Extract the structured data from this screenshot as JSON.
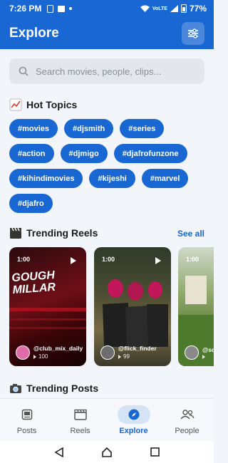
{
  "status_bar": {
    "time": "7:26 PM",
    "battery": "77%",
    "signal_label": "VoLTE"
  },
  "header": {
    "title": "Explore"
  },
  "search": {
    "placeholder": "Search movies, people, clips..."
  },
  "hot_topics": {
    "title": "Hot Topics",
    "chips": [
      [
        "#movies",
        "#djsmith",
        "#series"
      ],
      [
        "#action",
        "#djmigo",
        "#djafrofunzone"
      ],
      [
        "#kihindimovies",
        "#kijeshi",
        "#marvel"
      ],
      [
        "#djafro"
      ]
    ]
  },
  "trending_reels": {
    "title": "Trending Reels",
    "see_all": "See all",
    "items": [
      {
        "duration": "1:00",
        "user": "@club_mix_daily",
        "views": "100"
      },
      {
        "duration": "1:00",
        "user": "@flick_finder",
        "views": "99"
      },
      {
        "duration": "1:00",
        "user": "@scr",
        "views": ""
      }
    ],
    "reel1_overlay": [
      "GOUGH",
      "MILLAR"
    ]
  },
  "trending_posts": {
    "title": "Trending Posts"
  },
  "bottom_nav": {
    "items": [
      {
        "label": "Posts",
        "active": false
      },
      {
        "label": "Reels",
        "active": false
      },
      {
        "label": "Explore",
        "active": true
      },
      {
        "label": "People",
        "active": false
      }
    ]
  },
  "colors": {
    "primary": "#1967d2",
    "active_pill": "#d5e3f7"
  }
}
